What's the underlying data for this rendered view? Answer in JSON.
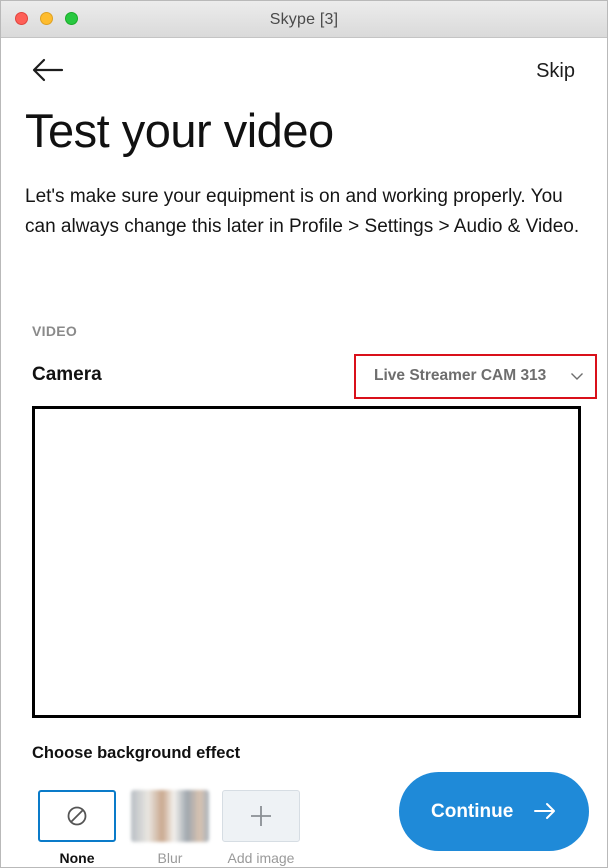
{
  "window": {
    "title": "Skype [3]",
    "controls": [
      "close",
      "minimize",
      "zoom"
    ]
  },
  "header": {
    "back_icon": "arrow-left-icon",
    "skip_label": "Skip"
  },
  "page": {
    "title": "Test your video",
    "description": "Let's make sure your equipment is on and working properly. You can always change this later in Profile > Settings > Audio & Video."
  },
  "video": {
    "section_label": "VIDEO",
    "camera_label": "Camera",
    "camera_selected": "Live Streamer CAM 313",
    "highlight_color": "#d9101a"
  },
  "background_effect": {
    "label": "Choose background effect",
    "options": [
      {
        "label": "None",
        "icon": "none-icon",
        "selected": true
      },
      {
        "label": "Blur",
        "icon": "blur-thumbnail",
        "selected": false
      },
      {
        "label": "Add image",
        "icon": "plus-icon",
        "selected": false
      }
    ]
  },
  "footer": {
    "continue_label": "Continue",
    "continue_icon": "arrow-right-icon",
    "accent_color": "#1f8ad8"
  }
}
